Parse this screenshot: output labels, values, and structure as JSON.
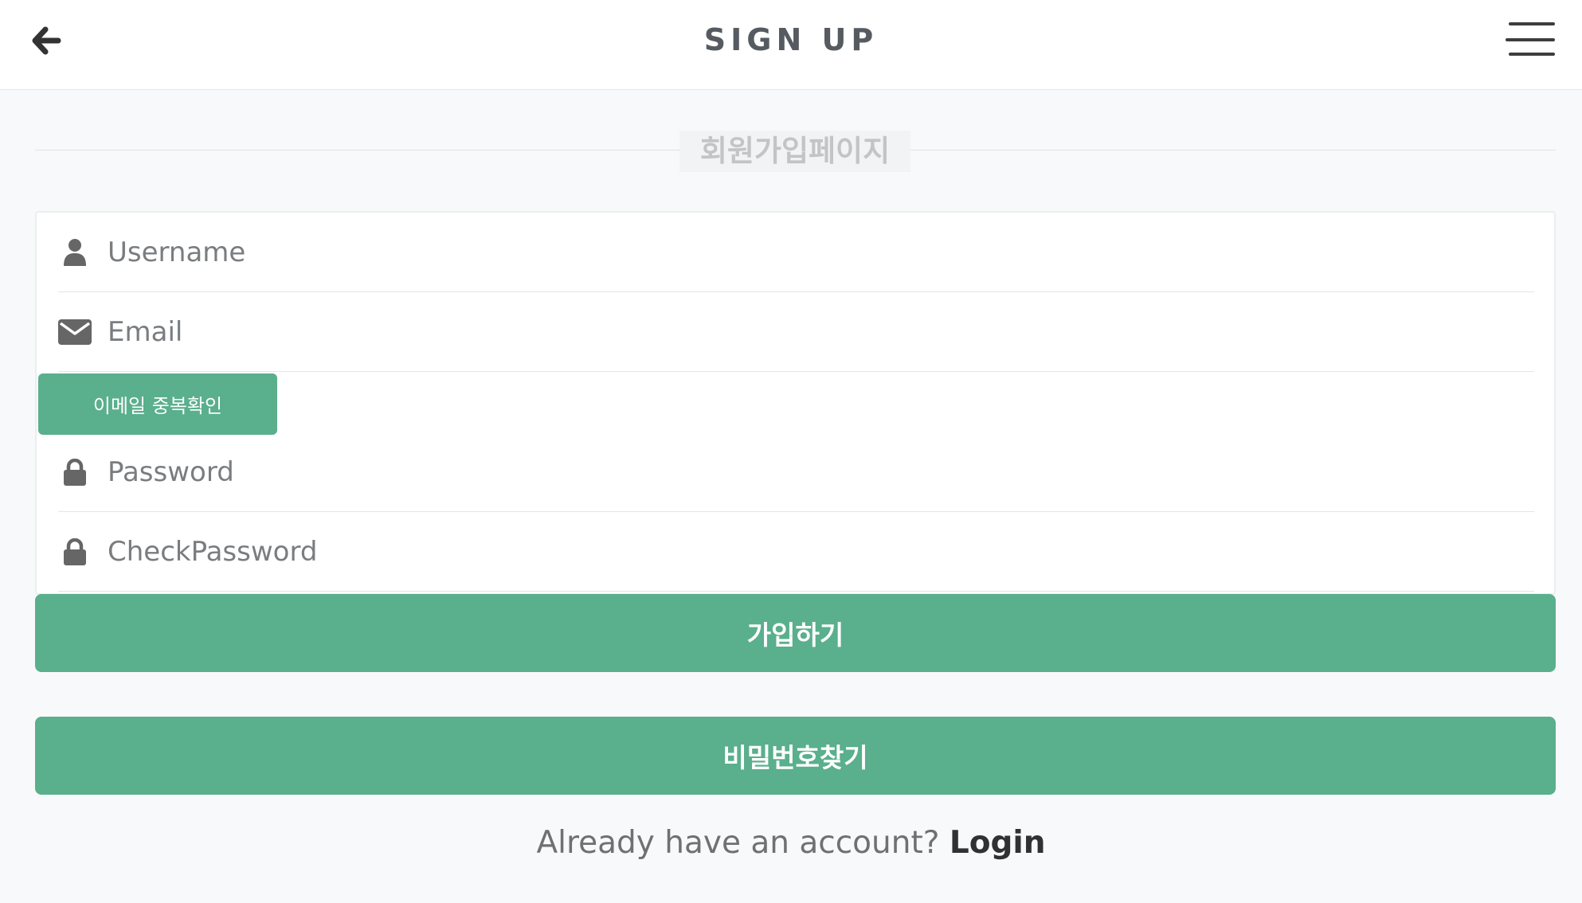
{
  "header": {
    "title": "SIGN UP",
    "back_icon": "arrow-left-icon",
    "menu_icon": "hamburger-menu-icon"
  },
  "section": {
    "heading": "회원가입페이지"
  },
  "form": {
    "username_placeholder": "Username",
    "email_placeholder": "Email",
    "check_email_label": "이메일 중복확인",
    "password_placeholder": "Password",
    "check_password_placeholder": "CheckPassword"
  },
  "actions": {
    "signup_label": "가입하기",
    "find_password_label": "비밀번호찾기"
  },
  "footer": {
    "prompt": "Already have an account? ",
    "login_label": "Login"
  },
  "colors": {
    "accent": "#5aaf8d",
    "background": "#f8f9fa",
    "header_bg": "#ffffff",
    "title_text": "#555b61"
  }
}
